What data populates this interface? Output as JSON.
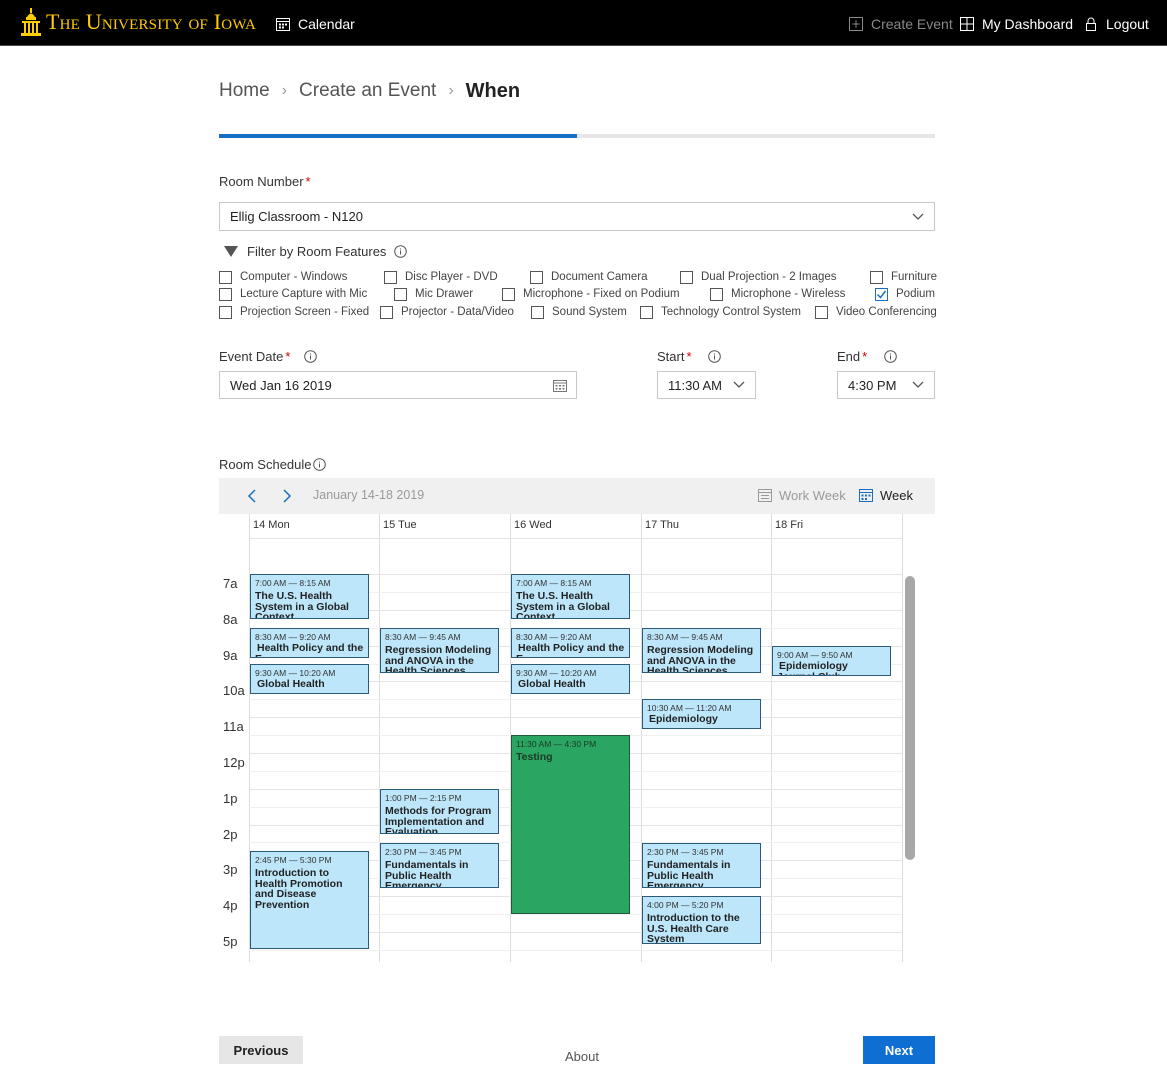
{
  "topbar": {
    "logo_text": "The University of Iowa",
    "calendar_label": "Calendar",
    "create_event_label": "Create Event",
    "dashboard_label": "My Dashboard",
    "logout_label": "Logout"
  },
  "breadcrumb": {
    "home": "Home",
    "create": "Create an Event",
    "current": "When"
  },
  "progress": {
    "fraction": 0.5
  },
  "room": {
    "label": "Room Number",
    "required_mark": "*",
    "value": "Ellig Classroom - N120",
    "filter_label": "Filter by Room Features"
  },
  "features": [
    {
      "label": "Computer - Windows",
      "checked": false
    },
    {
      "label": "Disc Player - DVD",
      "checked": false
    },
    {
      "label": "Document Camera",
      "checked": false
    },
    {
      "label": "Dual Projection - 2 Images",
      "checked": false
    },
    {
      "label": "Furniture",
      "checked": false
    },
    {
      "label": "Lecture Capture with Mic",
      "checked": false
    },
    {
      "label": "Mic Drawer",
      "checked": false
    },
    {
      "label": "Microphone - Fixed on Podium",
      "checked": false
    },
    {
      "label": "Microphone - Wireless",
      "checked": false
    },
    {
      "label": "Podium",
      "checked": true
    },
    {
      "label": "Projection Screen - Fixed",
      "checked": false
    },
    {
      "label": "Projector - Data/Video",
      "checked": false
    },
    {
      "label": "Sound System",
      "checked": false
    },
    {
      "label": "Technology Control System",
      "checked": false
    },
    {
      "label": "Video Conferencing",
      "checked": false
    }
  ],
  "event_date": {
    "label": "Event Date",
    "value": "Wed Jan 16 2019"
  },
  "start": {
    "label": "Start",
    "value": "11:30 AM"
  },
  "end": {
    "label": "End",
    "value": "4:30 PM"
  },
  "schedule": {
    "label": "Room Schedule",
    "range": "January 14-18 2019",
    "work_week_label": "Work Week",
    "week_label": "Week",
    "days": [
      "14 Mon",
      "15 Tue",
      "16 Wed",
      "17 Thu",
      "18 Fri"
    ],
    "hours": [
      "7a",
      "8a",
      "9a",
      "10a",
      "11a",
      "12p",
      "1p",
      "2p",
      "3p",
      "4p",
      "5p"
    ],
    "events": [
      {
        "day": 0,
        "start": 7.0,
        "end": 8.25,
        "time": "7:00 AM — 8:15 AM",
        "name": "The U.S. Health System in a Global Context"
      },
      {
        "day": 0,
        "start": 8.5,
        "end": 9.333,
        "time": "8:30 AM — 9:20 AM",
        "name": "Health Policy and the E",
        "inline": true
      },
      {
        "day": 0,
        "start": 9.5,
        "end": 10.333,
        "time": "9:30 AM — 10:20 AM",
        "name": "Global Health",
        "inline": true
      },
      {
        "day": 0,
        "start": 14.75,
        "end": 17.5,
        "time": "2:45 PM — 5:30 PM",
        "name": "Introduction to Health Promotion and Disease Prevention"
      },
      {
        "day": 1,
        "start": 8.5,
        "end": 9.75,
        "time": "8:30 AM — 9:45 AM",
        "name": "Regression Modeling and ANOVA in the Health Sciences"
      },
      {
        "day": 1,
        "start": 13.0,
        "end": 14.25,
        "time": "1:00 PM — 2:15 PM",
        "name": "Methods for Program Implementation and Evaluation"
      },
      {
        "day": 1,
        "start": 14.5,
        "end": 15.75,
        "time": "2:30 PM — 3:45 PM",
        "name": "Fundamentals in Public Health Emergency Preparedness"
      },
      {
        "day": 2,
        "start": 7.0,
        "end": 8.25,
        "time": "7:00 AM — 8:15 AM",
        "name": "The U.S. Health System in a Global Context"
      },
      {
        "day": 2,
        "start": 8.5,
        "end": 9.333,
        "time": "8:30 AM — 9:20 AM",
        "name": "Health Policy and the E",
        "inline": true
      },
      {
        "day": 2,
        "start": 9.5,
        "end": 10.333,
        "time": "9:30 AM — 10:20 AM",
        "name": "Global Health",
        "inline": true
      },
      {
        "day": 2,
        "start": 11.5,
        "end": 16.5,
        "time": "11:30 AM — 4:30 PM",
        "name": "Testing",
        "green": true
      },
      {
        "day": 3,
        "start": 8.5,
        "end": 9.75,
        "time": "8:30 AM — 9:45 AM",
        "name": "Regression Modeling and ANOVA in the Health Sciences"
      },
      {
        "day": 3,
        "start": 10.5,
        "end": 11.333,
        "time": "10:30 AM — 11:20 AM",
        "name": "Epidemiology",
        "inline": true
      },
      {
        "day": 3,
        "start": 14.5,
        "end": 15.75,
        "time": "2:30 PM — 3:45 PM",
        "name": "Fundamentals in Public Health Emergency Preparedness"
      },
      {
        "day": 3,
        "start": 16.0,
        "end": 17.333,
        "time": "4:00 PM — 5:20 PM",
        "name": "Introduction to the U.S. Health Care System"
      },
      {
        "day": 4,
        "start": 9.0,
        "end": 9.833,
        "time": "9:00 AM — 9:50 AM",
        "name": "Epidemiology Journal Club",
        "inline": true
      }
    ]
  },
  "footer": {
    "previous_label": "Previous",
    "next_label": "Next",
    "about_label": "About"
  }
}
